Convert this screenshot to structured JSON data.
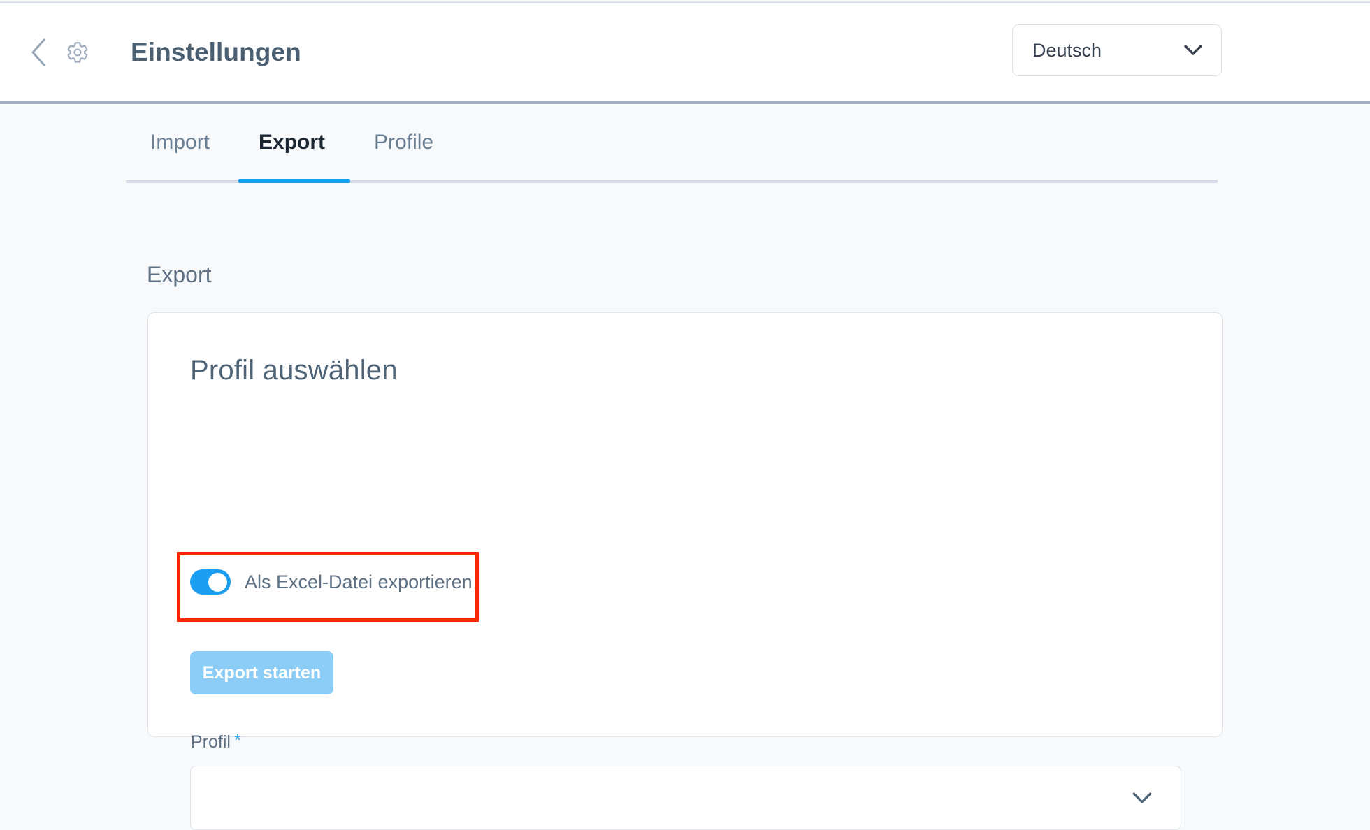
{
  "window": {
    "title": "Einstellungen"
  },
  "header": {
    "title": "Einstellungen",
    "back_icon": "chevron-left-icon",
    "settings_icon": "gear-icon",
    "language": {
      "selected": "Deutsch",
      "chevron_icon": "chevron-down-icon"
    }
  },
  "tabs": [
    {
      "label": "Import",
      "active": false
    },
    {
      "label": "Export",
      "active": true
    },
    {
      "label": "Profile",
      "active": false
    }
  ],
  "main": {
    "section_title": "Export",
    "card": {
      "title": "Profil auswählen",
      "profile_field": {
        "label": "Profil",
        "required_marker": "*",
        "value": "",
        "placeholder": "",
        "chevron_icon": "chevron-down-icon"
      },
      "excel_toggle": {
        "label": "Als Excel-Datei exportieren",
        "state": "on",
        "highlighted": true
      },
      "submit_button": {
        "label": "Export starten",
        "enabled": false
      }
    }
  },
  "colors": {
    "accent_blue": "#1b9df0",
    "accent_blue_disabled": "#8ccdf7",
    "required_blue": "#2fa3f2",
    "highlight_red": "#fa2600",
    "page_background": "#f7f9fb",
    "card_background": "#ffffff",
    "text_primary": "#4f6376",
    "text_muted": "#6b7f93",
    "header_rule": "#a3b1c2"
  }
}
